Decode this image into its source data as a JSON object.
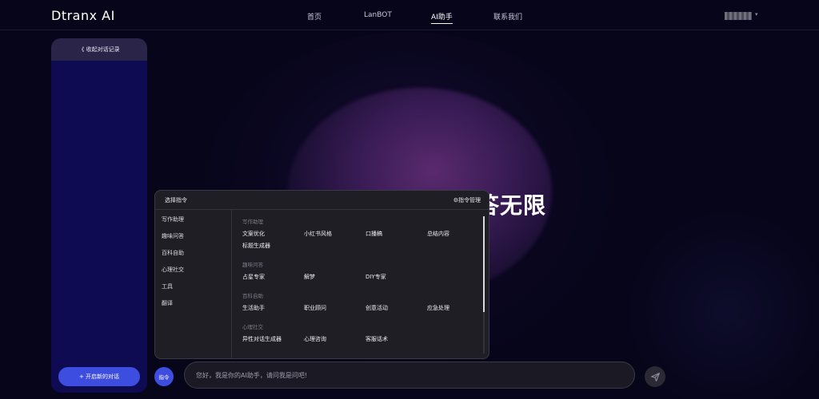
{
  "header": {
    "logo": "Dtranx  AI",
    "nav": [
      {
        "label": "首页"
      },
      {
        "label": "LanBOT"
      },
      {
        "label": "AI助手",
        "active": true
      },
      {
        "label": "联系我们"
      }
    ]
  },
  "sidebar": {
    "collapse_label": "《 收起对话记录",
    "new_chat_label": "+ 开启新的对话"
  },
  "hero": {
    "text": "答无限"
  },
  "popup": {
    "title": "选择指令",
    "manage_label": "⚙指令管理",
    "categories": [
      "写作助理",
      "趣味问答",
      "百科自助",
      "心理社交",
      "工具",
      "翻译"
    ],
    "sections": [
      {
        "title": "写作助理",
        "items": [
          "文案优化",
          "小红书风格",
          "口播稿",
          "总结内容",
          "标题生成器"
        ]
      },
      {
        "title": "趣味问答",
        "items": [
          "占星专家",
          "解梦",
          "DIY专家"
        ]
      },
      {
        "title": "百科自助",
        "items": [
          "生活助手",
          "职业顾问",
          "创意活动",
          "应急处理"
        ]
      },
      {
        "title": "心理社交",
        "items": [
          "异性对话生成器",
          "心理咨询",
          "客服话术"
        ]
      }
    ]
  },
  "input": {
    "cmd_button": "指令",
    "placeholder": "您好，我是你的AI助手，请问我是问吧!"
  },
  "colors": {
    "accent": "#3d4de0",
    "background": "#07051a",
    "sidebar": "#0e0b52",
    "popup": "#1f1e25"
  }
}
